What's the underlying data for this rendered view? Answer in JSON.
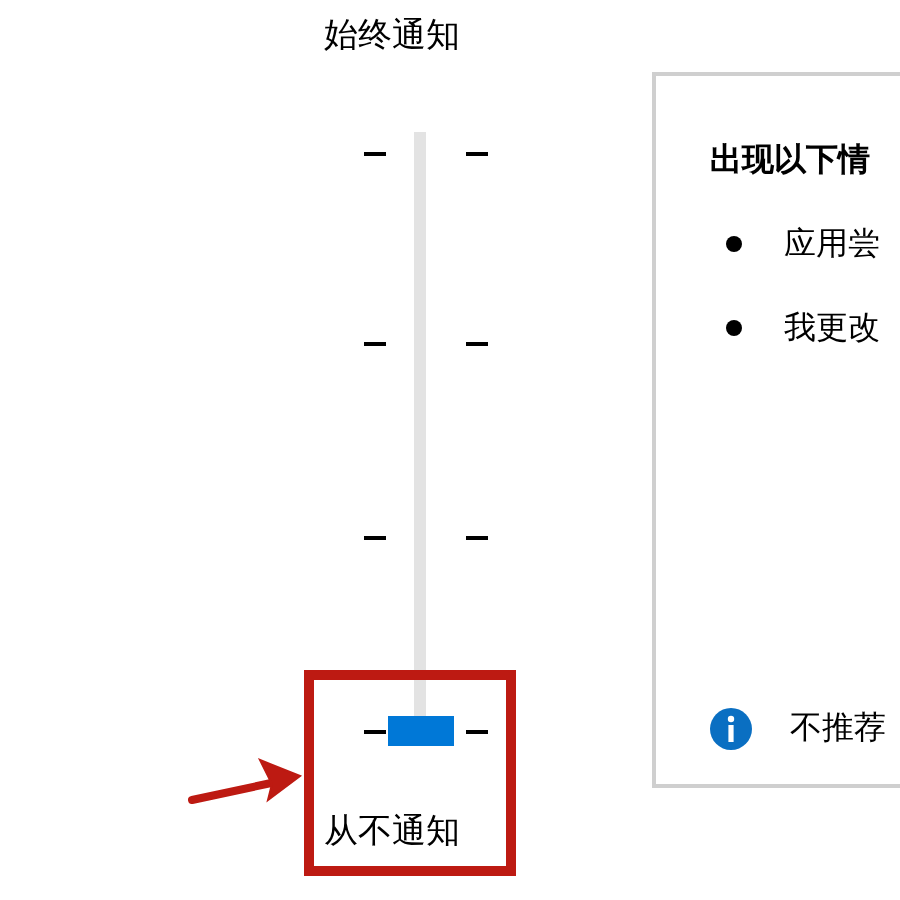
{
  "slider": {
    "top_label": "始终通知",
    "bottom_label": "从不通知",
    "level": 0
  },
  "panel": {
    "title": "出现以下情",
    "bullets": [
      "应用尝",
      "我更改"
    ],
    "note": "不推荐"
  }
}
